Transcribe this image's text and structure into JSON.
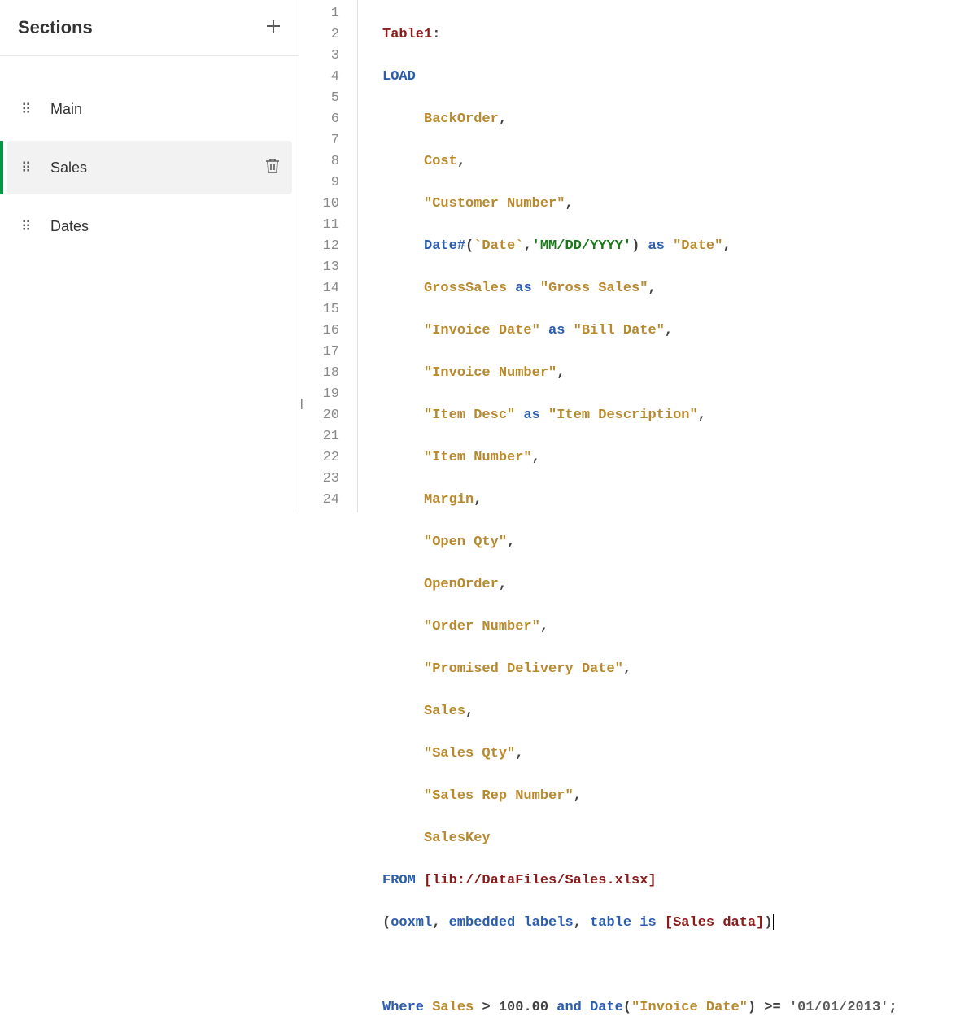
{
  "sidebar": {
    "title": "Sections",
    "items": [
      {
        "label": "Main",
        "selected": false
      },
      {
        "label": "Sales",
        "selected": true
      },
      {
        "label": "Dates",
        "selected": false
      }
    ]
  },
  "editor": {
    "line_count": 24,
    "tokens": {
      "l1_table": "Table1",
      "l1_colon": ":",
      "l2_load": "LOAD",
      "l3_f": "BackOrder",
      "l4_f": "Cost",
      "l5_f": "\"Customer Number\"",
      "l6_func": "Date#",
      "l6_open": "(",
      "l6_bt": "`Date`",
      "l6_cm": ",",
      "l6_fmt": "'MM/DD/YYYY'",
      "l6_close": ")",
      "l6_as": "as",
      "l6_alias": "\"Date\"",
      "l7_a": "GrossSales",
      "l7_as": "as",
      "l7_b": "\"Gross Sales\"",
      "l8_a": "\"Invoice Date\"",
      "l8_as": "as",
      "l8_b": "\"Bill Date\"",
      "l9_f": "\"Invoice Number\"",
      "l10_a": "\"Item Desc\"",
      "l10_as": "as",
      "l10_b": "\"Item Description\"",
      "l11_f": "\"Item Number\"",
      "l12_f": "Margin",
      "l13_f": "\"Open Qty\"",
      "l14_f": "OpenOrder",
      "l15_f": "\"Order Number\"",
      "l16_f": "\"Promised Delivery Date\"",
      "l17_f": "Sales",
      "l18_f": "\"Sales Qty\"",
      "l19_f": "\"Sales Rep Number\"",
      "l20_f": "SalesKey",
      "l21_from": "FROM",
      "l21_path": "[lib://DataFiles/Sales.xlsx]",
      "l22_open": "(",
      "l22_a": "ooxml",
      "l22_b": "embedded",
      "l22_c": "labels",
      "l22_d": "table",
      "l22_e": "is",
      "l22_tbl": "[Sales data]",
      "l22_close": ")",
      "l24_where": "Where",
      "l24_sales": "Sales",
      "l24_gt": ">",
      "l24_num": "100.00",
      "l24_and": "and",
      "l24_datefn": "Date",
      "l24_open": "(",
      "l24_inv": "\"Invoice Date\"",
      "l24_close": ")",
      "l24_gte": ">=",
      "l24_dt": "'01/01/2013'",
      "l24_semi": ";",
      "comma": ","
    }
  }
}
